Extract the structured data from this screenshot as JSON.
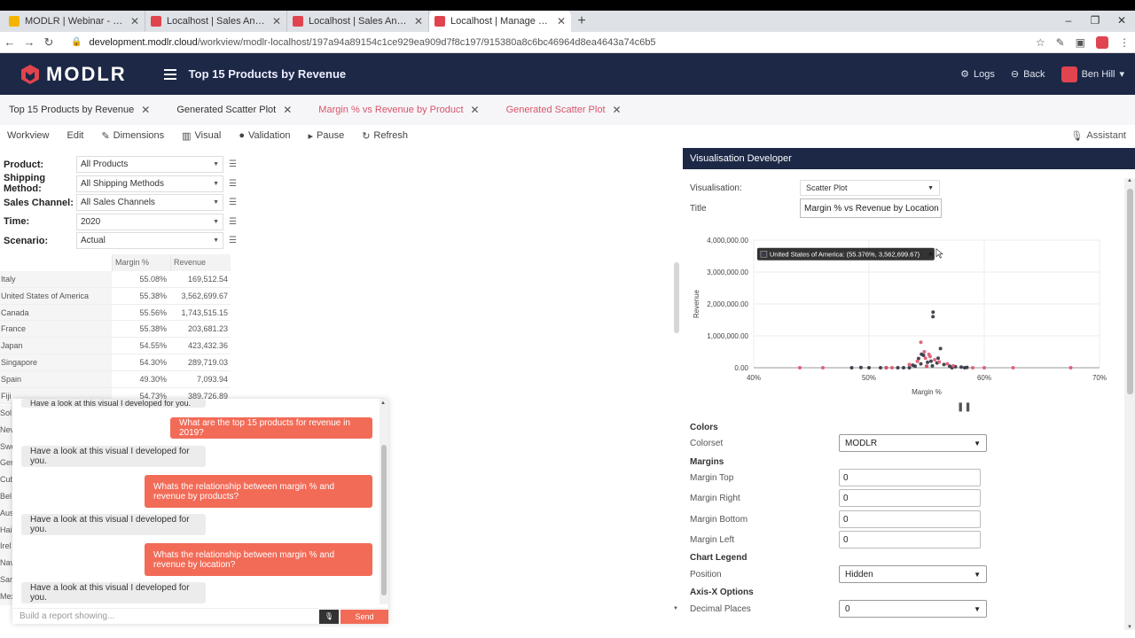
{
  "browser": {
    "tabs": [
      {
        "label": "MODLR | Webinar - Google Slide",
        "fav": "#f4b400",
        "active": false
      },
      {
        "label": "Localhost | Sales Analysis | MOD",
        "fav": "#e0444e",
        "active": false
      },
      {
        "label": "Localhost | Sales Analysis | MOD",
        "fav": "#e0444e",
        "active": false
      },
      {
        "label": "Localhost | Manage Workview | T",
        "fav": "#e0444e",
        "active": true
      }
    ],
    "new_tab": "+",
    "url_domain": "development.modlr.cloud",
    "url_path": "/workview/modlr-localhost/197a94a89154c1ce929ea909d7f8c197/915380a8c6bc46964d8ea4643a74c6b5"
  },
  "header": {
    "logo_text": "MODLR",
    "page_title": "Top 15 Products by Revenue",
    "logs": "Logs",
    "back": "Back",
    "user": "Ben Hill"
  },
  "workview_tabs": [
    {
      "label": "Top 15 Products by Revenue",
      "pink": false
    },
    {
      "label": "Generated Scatter Plot",
      "pink": false
    },
    {
      "label": "Margin % vs Revenue by Product",
      "pink": true
    },
    {
      "label": "Generated Scatter Plot",
      "pink": true
    }
  ],
  "toolbar": {
    "workview": "Workview",
    "edit": "Edit",
    "dimensions": "Dimensions",
    "visual": "Visual",
    "validation": "Validation",
    "pause": "Pause",
    "refresh": "Refresh",
    "assistant": "Assistant"
  },
  "filters": [
    {
      "label": "Product:",
      "value": "All Products"
    },
    {
      "label": "Shipping Method:",
      "value": "All Shipping Methods"
    },
    {
      "label": "Sales Channel:",
      "value": "All Sales Channels"
    },
    {
      "label": "Time:",
      "value": "2020"
    },
    {
      "label": "Scenario:",
      "value": "Actual"
    }
  ],
  "table": {
    "headers": [
      "Margin %",
      "Revenue"
    ],
    "rows": [
      {
        "name": "Italy",
        "margin": "55.08%",
        "revenue": "169,512.54"
      },
      {
        "name": "United States of America",
        "margin": "55.38%",
        "revenue": "3,562,699.67"
      },
      {
        "name": "Canada",
        "margin": "55.56%",
        "revenue": "1,743,515.15"
      },
      {
        "name": "France",
        "margin": "55.38%",
        "revenue": "203,681.23"
      },
      {
        "name": "Japan",
        "margin": "54.55%",
        "revenue": "423,432.36"
      },
      {
        "name": "Singapore",
        "margin": "54.30%",
        "revenue": "289,719.03"
      },
      {
        "name": "Spain",
        "margin": "49.30%",
        "revenue": "7,093.94"
      },
      {
        "name": "Fiji",
        "margin": "54.73%",
        "revenue": "389,726.89"
      }
    ],
    "stub_rows": [
      "Sol",
      "Nev",
      "Swe",
      "Ger",
      "Cub",
      "Bel",
      "Aus",
      "Hai",
      "Irel",
      "Nav",
      "San",
      "Mex"
    ]
  },
  "chat": {
    "top_partial": "Have a look at this visual I developed for you.",
    "messages": [
      {
        "role": "user",
        "text": "What are the top 15 products for revenue in 2019?"
      },
      {
        "role": "bot",
        "text": "Have a look at this visual I developed for you."
      },
      {
        "role": "user",
        "text": "Whats the relationship between margin % and revenue by products?"
      },
      {
        "role": "bot",
        "text": "Have a look at this visual I developed for you."
      },
      {
        "role": "user",
        "text": "Whats the relationship between margin % and revenue by location?"
      },
      {
        "role": "bot",
        "text": "Have a look at this visual I developed for you."
      }
    ],
    "input_placeholder": "Build a report showing...",
    "send": "Send"
  },
  "vis_dev": {
    "header": "Visualisation Developer",
    "visualisation_label": "Visualisation:",
    "visualisation_value": "Scatter Plot",
    "title_label": "Title",
    "title_value": "Margin % vs Revenue by Location",
    "tooltip": "United States of America: (55.376%, 3,562,699.67)",
    "colors_section": "Colors",
    "colorset_label": "Colorset",
    "colorset_value": "MODLR",
    "margins_section": "Margins",
    "margin_top_label": "Margin Top",
    "margin_top_value": "0",
    "margin_right_label": "Margin Right",
    "margin_right_value": "0",
    "margin_bottom_label": "Margin Bottom",
    "margin_bottom_value": "0",
    "margin_left_label": "Margin Left",
    "margin_left_value": "0",
    "legend_section": "Chart Legend",
    "position_label": "Position",
    "position_value": "Hidden",
    "axisx_section": "Axis-X Options",
    "decimal_label": "Decimal Places",
    "decimal_value": "0"
  },
  "chart_data": {
    "type": "scatter",
    "title": "",
    "xlabel": "Margin %",
    "ylabel": "Revenue",
    "xlim": [
      40,
      70
    ],
    "ylim": [
      0,
      4000000
    ],
    "xticks": [
      "40%",
      "50%",
      "60%",
      "70%"
    ],
    "yticks": [
      "0.00",
      "1,000,000.00",
      "2,000,000.00",
      "3,000,000.00",
      "4,000,000.00"
    ],
    "grid": true,
    "legend": "hidden",
    "series": [
      {
        "color": "#333340",
        "points": [
          [
            48.5,
            0
          ],
          [
            49.3,
            7093.94
          ],
          [
            50.0,
            0
          ],
          [
            51.0,
            0
          ],
          [
            51.5,
            0
          ],
          [
            52.5,
            0
          ],
          [
            53.0,
            0
          ],
          [
            53.5,
            0
          ],
          [
            54.0,
            50000
          ],
          [
            54.3,
            289719.03
          ],
          [
            54.55,
            423432.36
          ],
          [
            54.73,
            389726.89
          ],
          [
            55.08,
            169512.54
          ],
          [
            55.38,
            203681.23
          ],
          [
            55.56,
            1743515.15
          ],
          [
            55.55,
            1600000
          ],
          [
            56.2,
            600000
          ],
          [
            55.9,
            150000
          ],
          [
            56.5,
            100000
          ],
          [
            57.0,
            50000
          ],
          [
            57.5,
            30000
          ],
          [
            58.0,
            20000
          ],
          [
            58.5,
            10000
          ],
          [
            55.5,
            60000
          ],
          [
            56.0,
            300000
          ],
          [
            55.0,
            50000
          ],
          [
            54.5,
            120000
          ],
          [
            53.8,
            80000
          ],
          [
            57.2,
            0
          ],
          [
            58.3,
            0
          ]
        ]
      },
      {
        "color": "#e05570",
        "points": [
          [
            44.0,
            0
          ],
          [
            46.0,
            0
          ],
          [
            51.5,
            0
          ],
          [
            52.0,
            0
          ],
          [
            54.5,
            800000
          ],
          [
            54.8,
            500000
          ],
          [
            55.3,
            350000
          ],
          [
            55.7,
            250000
          ],
          [
            56.1,
            180000
          ],
          [
            54.2,
            200000
          ],
          [
            53.5,
            100000
          ],
          [
            55.0,
            40000
          ],
          [
            56.8,
            120000
          ],
          [
            57.3,
            60000
          ],
          [
            59.0,
            0
          ],
          [
            60.0,
            0
          ],
          [
            62.5,
            0
          ],
          [
            67.5,
            0
          ],
          [
            55.2,
            420000
          ],
          [
            54.9,
            300000
          ]
        ]
      }
    ],
    "highlight": {
      "label": "United States of America",
      "x": 55.376,
      "y": 3562699.67
    }
  }
}
